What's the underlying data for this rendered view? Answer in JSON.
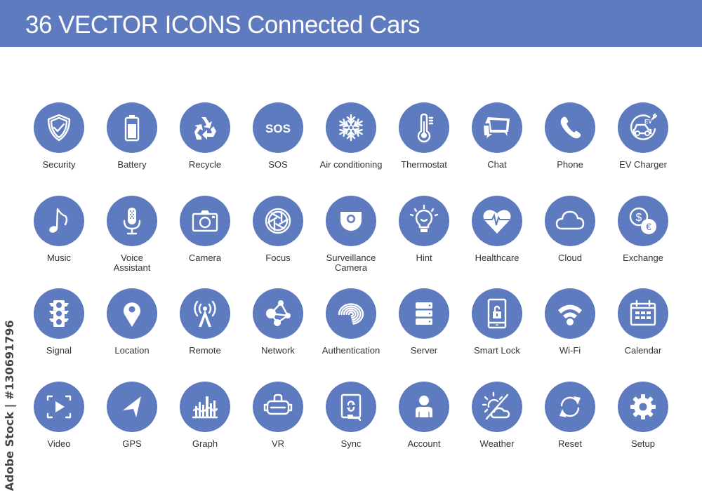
{
  "header": {
    "title": "36 VECTOR ICONS  Connected Cars",
    "background": "#5f7bbf"
  },
  "side_watermark": "Adobe Stock | #130691796",
  "colors": {
    "icon_circle": "#5f7bbf",
    "icon_glyph": "#ffffff",
    "label_text": "#333333"
  },
  "icons": [
    {
      "label": "Security",
      "icon": "shield-check-icon"
    },
    {
      "label": "Battery",
      "icon": "battery-icon"
    },
    {
      "label": "Recycle",
      "icon": "recycle-icon"
    },
    {
      "label": "SOS",
      "icon": "sos-icon",
      "glyph_text": "SOS"
    },
    {
      "label": "Air conditioning",
      "icon": "snowflake-icon"
    },
    {
      "label": "Thermostat",
      "icon": "thermometer-icon"
    },
    {
      "label": "Chat",
      "icon": "chat-bubbles-icon"
    },
    {
      "label": "Phone",
      "icon": "phone-handset-icon"
    },
    {
      "label": "EV Charger",
      "icon": "ev-charger-icon",
      "glyph_text": "EV"
    },
    {
      "label": "Music",
      "icon": "music-note-icon"
    },
    {
      "label": "Voice\nAssistant",
      "icon": "microphone-icon"
    },
    {
      "label": "Camera",
      "icon": "camera-icon"
    },
    {
      "label": "Focus",
      "icon": "aperture-icon"
    },
    {
      "label": "Surveillance\nCamera",
      "icon": "dome-camera-icon"
    },
    {
      "label": "Hint",
      "icon": "lightbulb-icon"
    },
    {
      "label": "Healthcare",
      "icon": "heart-pulse-icon"
    },
    {
      "label": "Cloud",
      "icon": "cloud-icon"
    },
    {
      "label": "Exchange",
      "icon": "currency-exchange-icon",
      "glyph_text": "$€"
    },
    {
      "label": "Signal",
      "icon": "traffic-light-icon"
    },
    {
      "label": "Location",
      "icon": "map-pin-icon"
    },
    {
      "label": "Remote",
      "icon": "antenna-tower-icon"
    },
    {
      "label": "Network",
      "icon": "network-nodes-icon"
    },
    {
      "label": "Authentication",
      "icon": "fingerprint-icon"
    },
    {
      "label": "Server",
      "icon": "server-stack-icon"
    },
    {
      "label": "Smart Lock",
      "icon": "phone-unlock-icon"
    },
    {
      "label": "Wi-Fi",
      "icon": "wifi-icon"
    },
    {
      "label": "Calendar",
      "icon": "calendar-icon"
    },
    {
      "label": "Video",
      "icon": "video-play-icon"
    },
    {
      "label": "GPS",
      "icon": "navigation-arrow-icon"
    },
    {
      "label": "Graph",
      "icon": "bar-graph-icon"
    },
    {
      "label": "VR",
      "icon": "vr-headset-icon"
    },
    {
      "label": "Sync",
      "icon": "tablet-sync-icon"
    },
    {
      "label": "Account",
      "icon": "user-icon"
    },
    {
      "label": "Weather",
      "icon": "weather-sun-cloud-icon"
    },
    {
      "label": "Reset",
      "icon": "refresh-arrows-icon"
    },
    {
      "label": "Setup",
      "icon": "gear-icon"
    }
  ]
}
